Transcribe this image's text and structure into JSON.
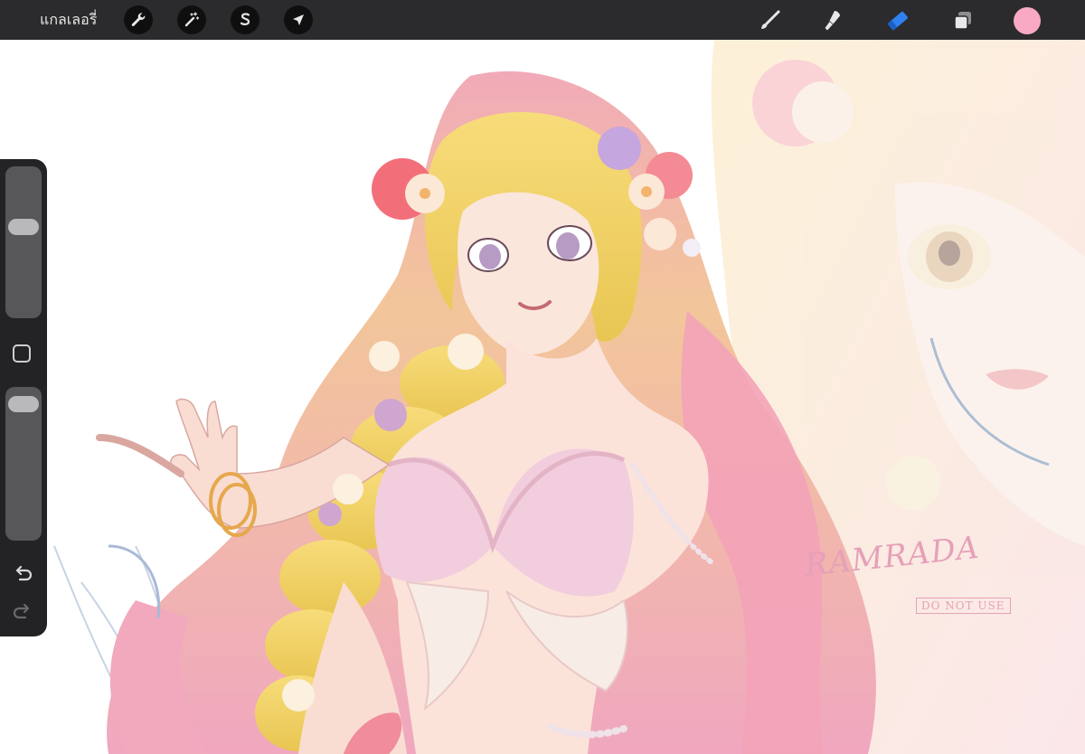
{
  "toolbar": {
    "gallery_label": "แกลเลอรี่",
    "left_tools": [
      {
        "name": "actions",
        "icon": "wrench-icon"
      },
      {
        "name": "adjustments",
        "icon": "magic-wand-icon"
      },
      {
        "name": "selection",
        "icon": "selection-s-icon"
      },
      {
        "name": "transform",
        "icon": "arrow-cursor-icon"
      }
    ],
    "right_tools": [
      {
        "name": "brush",
        "icon": "brush-icon",
        "active": false
      },
      {
        "name": "smudge",
        "icon": "smudge-icon",
        "active": false
      },
      {
        "name": "eraser",
        "icon": "eraser-icon",
        "active": true
      },
      {
        "name": "layers",
        "icon": "layers-icon",
        "active": false
      }
    ],
    "current_color": "#f9a9c3",
    "accent_color": "#2f80f0"
  },
  "sidebar": {
    "brush_size": 0.62,
    "brush_opacity": 0.95,
    "modify_icon": "square-icon",
    "undo_icon": "undo-icon",
    "redo_icon": "redo-icon"
  },
  "canvas": {
    "subject": "anime-girl-illustration",
    "watermark": {
      "name": "RAMRADA",
      "subtext": "DO NOT USE"
    }
  }
}
